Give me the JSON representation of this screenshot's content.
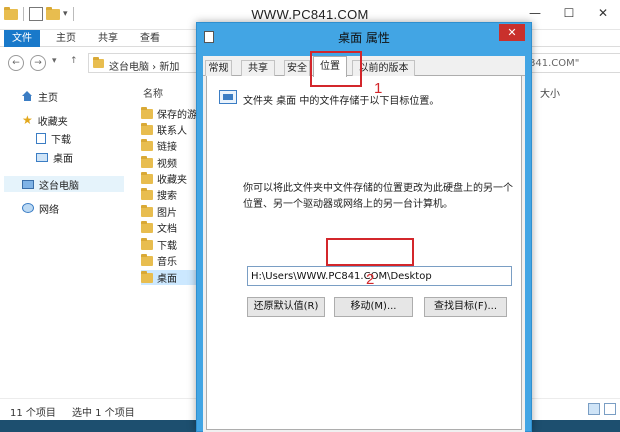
{
  "explorer": {
    "window_title": "WWW.PC841.COM",
    "window_controls": [
      "—",
      "☐",
      "✕"
    ],
    "ribbon_tabs": [
      "文件",
      "主页",
      "共享",
      "查看"
    ],
    "address": {
      "path": "这台电脑 › 新加"
    },
    "search": {
      "text": "841.COM\""
    },
    "nav_pane": {
      "home": "主页",
      "favorites": "收藏夹",
      "downloads": "下载",
      "desktop": "桌面",
      "this_pc": "这台电脑",
      "network": "网络"
    },
    "columns": {
      "name": "名称",
      "size": "大小"
    },
    "files": [
      "保存的游",
      "联系人",
      "链接",
      "视频",
      "收藏夹",
      "搜索",
      "图片",
      "文档",
      "下载",
      "音乐",
      "桌面"
    ],
    "selected_file": "桌面",
    "status": {
      "item_count": "11 个项目",
      "selection": "选中 1 个项目"
    }
  },
  "dialog": {
    "title": "桌面 属性",
    "close": "✕",
    "tabs": [
      "常规",
      "共享",
      "安全",
      "位置",
      "以前的版本"
    ],
    "active_tab": "位置",
    "description": "文件夹 桌面 中的文件存储于以下目标位置。",
    "paragraph": "你可以将此文件夹中文件存储的位置更改为此硬盘上的另一个位置、另一个驱动器或网络上的另一台计算机。",
    "path_value": "H:\\Users\\WWW.PC841.COM\\Desktop",
    "buttons": {
      "restore": "还原默认值(R)",
      "move": "移动(M)...",
      "find_target": "查找目标(F)..."
    }
  },
  "annotations": {
    "step1": "1",
    "step2": "2",
    "color": "#d3262b"
  },
  "colors": {
    "title_bar": "#42a5e4",
    "file_tab": "#1979ca",
    "close_button": "#c9302c"
  }
}
